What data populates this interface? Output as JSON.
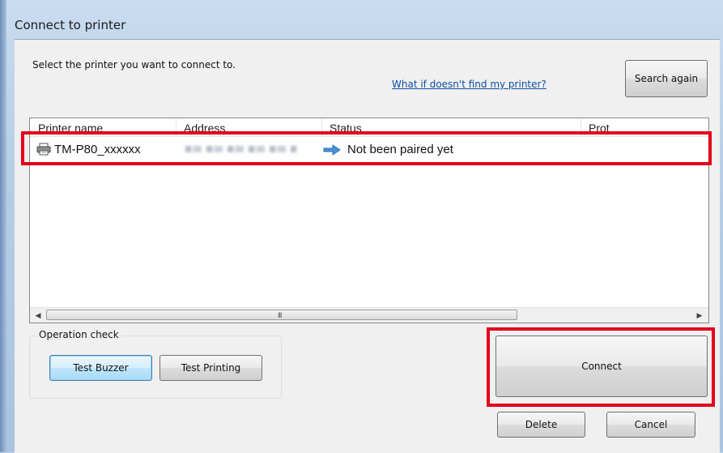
{
  "window": {
    "title": "Connect to printer"
  },
  "instruction": "Select the printer you want to connect to.",
  "help_link": "What if doesn't find my printer?",
  "search_button": "Search again",
  "table": {
    "columns": [
      "Printer name",
      "Address",
      "Status",
      "Prot"
    ],
    "rows": [
      {
        "name": "TM-P80_xxxxxx",
        "status": "Not been paired yet"
      }
    ]
  },
  "scrollbar": {
    "grip": "III"
  },
  "operation_check": {
    "label": "Operation check",
    "test_buzzer": "Test Buzzer",
    "test_printing": "Test Printing"
  },
  "buttons": {
    "connect": "Connect",
    "delete": "Delete",
    "cancel": "Cancel"
  },
  "colors": {
    "highlight": "#e3001b",
    "link": "#0b4fa5",
    "arrow": "#2f7fcf"
  }
}
